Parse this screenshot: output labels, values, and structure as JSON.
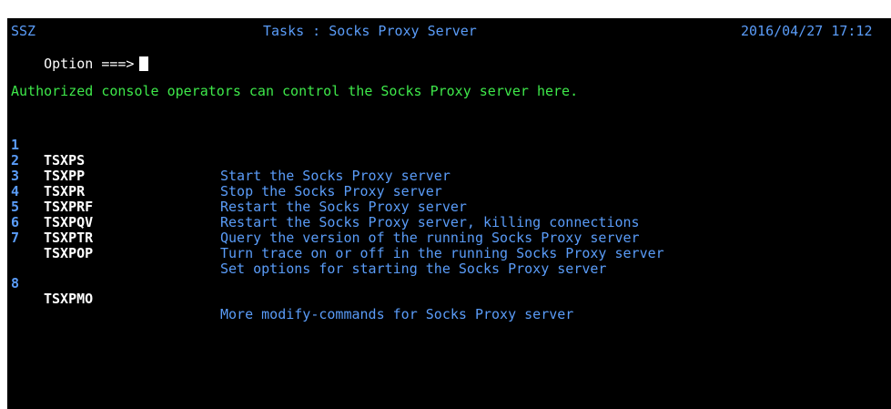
{
  "header": {
    "system_id": "SSZ",
    "title": "Tasks : Socks Proxy Server",
    "datetime": "2016/04/27 17:12"
  },
  "command": {
    "prompt": "Option ===>",
    "value": ""
  },
  "info_message": "Authorized console operators can control the Socks Proxy server here.",
  "options": [
    {
      "num": "1",
      "cmd": "TSXPS",
      "desc": "Start the Socks Proxy server"
    },
    {
      "num": "2",
      "cmd": "TSXPP",
      "desc": "Stop the Socks Proxy server"
    },
    {
      "num": "3",
      "cmd": "TSXPR",
      "desc": "Restart the Socks Proxy server"
    },
    {
      "num": "4",
      "cmd": "TSXPRF",
      "desc": "Restart the Socks Proxy server, killing connections"
    },
    {
      "num": "5",
      "cmd": "TSXPQV",
      "desc": "Query the version of the running Socks Proxy server"
    },
    {
      "num": "6",
      "cmd": "TSXPTR",
      "desc": "Turn trace on or off in the running Socks Proxy server"
    },
    {
      "num": "7",
      "cmd": "TSXPOP",
      "desc": "Set options for starting the Socks Proxy server"
    },
    {
      "num": "8",
      "cmd": "TSXPMO",
      "desc": "More modify-commands for Socks Proxy server"
    }
  ],
  "colors": {
    "background": "#000000",
    "header_text": "#5a9cf8",
    "info_text": "#3ee84a",
    "command_text": "#ffffff",
    "description_text": "#5a9cf8"
  }
}
